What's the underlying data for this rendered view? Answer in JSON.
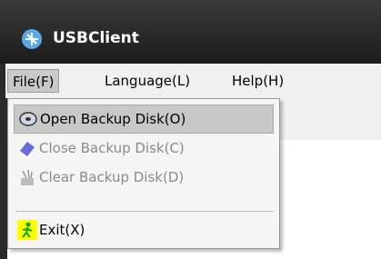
{
  "window": {
    "title": "USBClient",
    "icon": "usb-client-icon"
  },
  "menubar": {
    "items": [
      {
        "label": "File(F)"
      },
      {
        "label": "Language(L)"
      },
      {
        "label": "Help(H)"
      }
    ]
  },
  "file_menu": {
    "items": [
      {
        "label": "Open Backup Disk(O)",
        "icon": "open-disk-icon",
        "enabled": true,
        "highlighted": true
      },
      {
        "label": "Close Backup Disk(C)",
        "icon": "close-disk-icon",
        "enabled": false
      },
      {
        "label": "Clear Backup Disk(D)",
        "icon": "clear-disk-icon",
        "enabled": false
      },
      {
        "label": "Exit(X)",
        "icon": "exit-icon",
        "enabled": true
      }
    ]
  },
  "colors": {
    "titlebar": "#1c1c1c",
    "highlight": "#c8c8c8",
    "disabled_text": "#8a8a8a"
  }
}
